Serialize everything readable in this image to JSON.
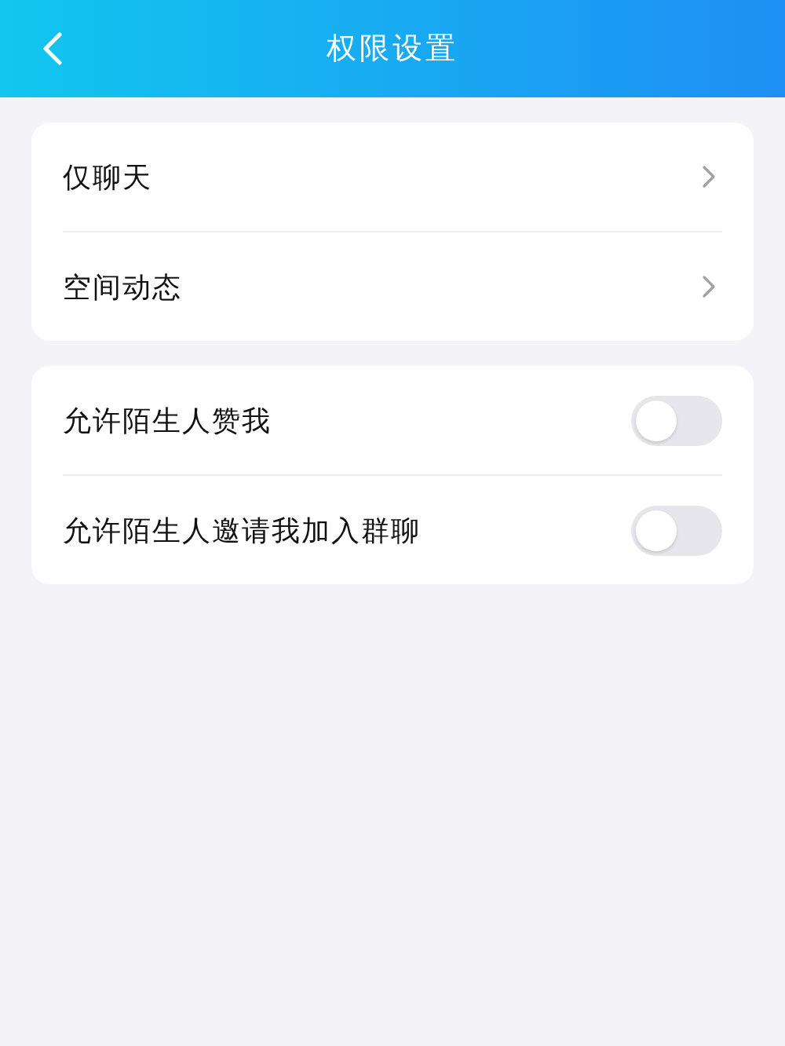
{
  "header": {
    "title": "权限设置"
  },
  "groups": [
    {
      "items": [
        {
          "kind": "link",
          "label": "仅聊天"
        },
        {
          "kind": "link",
          "label": "空间动态"
        }
      ]
    },
    {
      "items": [
        {
          "kind": "toggle",
          "label": "允许陌生人赞我",
          "on": false
        },
        {
          "kind": "toggle",
          "label": "允许陌生人邀请我加入群聊",
          "on": false
        }
      ]
    }
  ]
}
